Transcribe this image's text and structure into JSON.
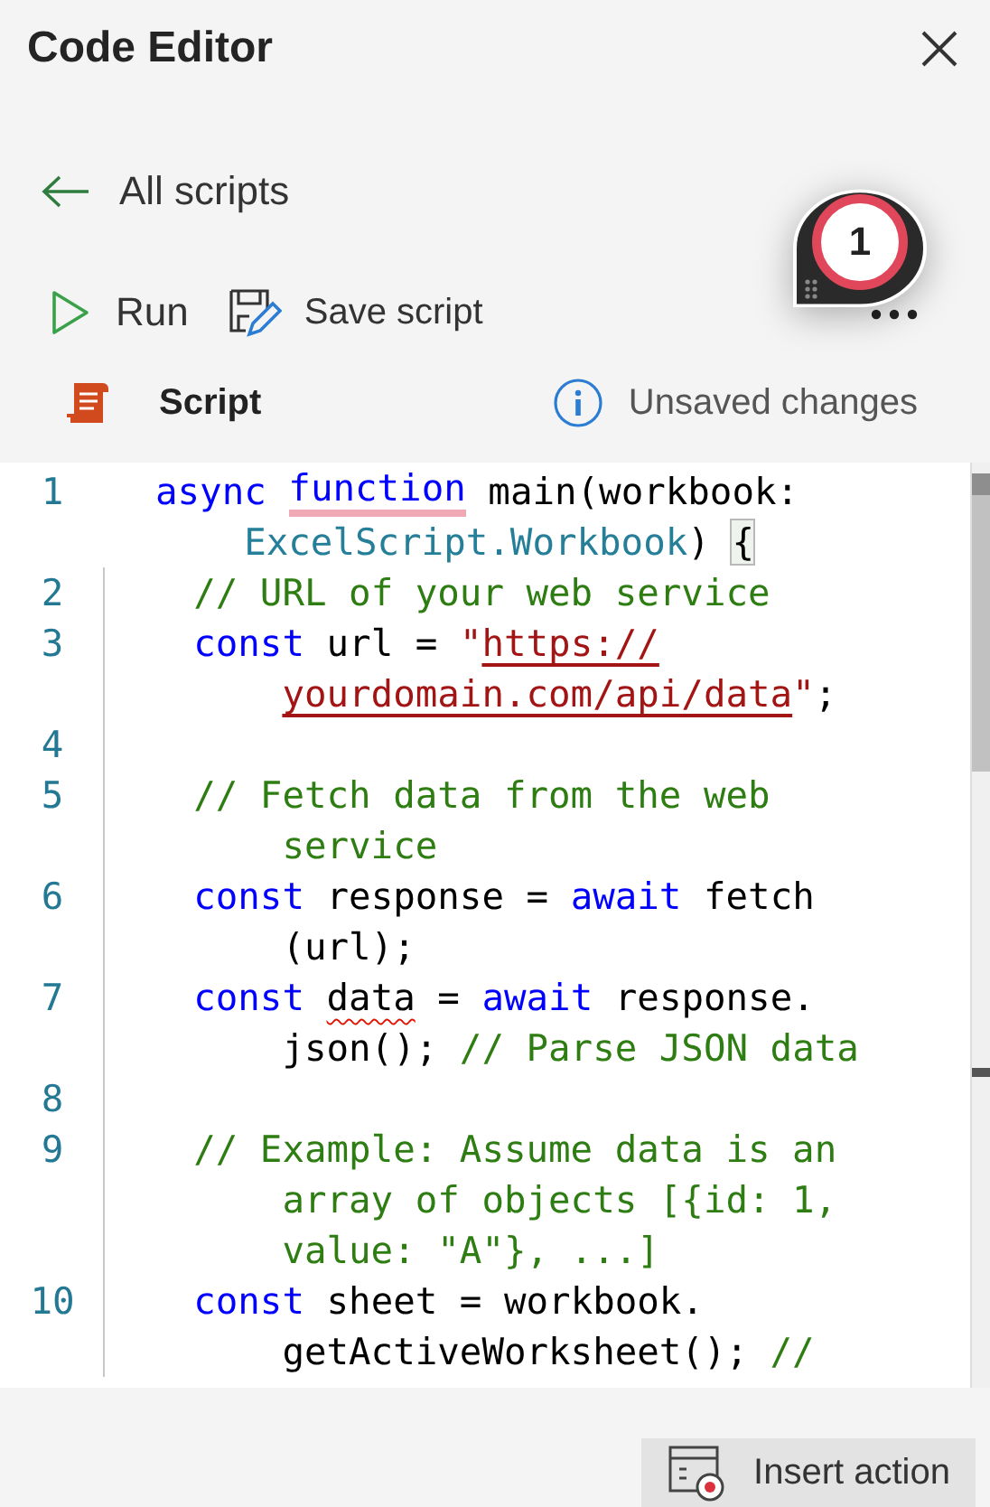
{
  "header": {
    "title": "Code Editor"
  },
  "back_link": {
    "label": "All scripts"
  },
  "toolbar": [
    {
      "kind": "run",
      "label": "Run"
    },
    {
      "kind": "save",
      "label": "Save script"
    }
  ],
  "step_badge": {
    "label": "1"
  },
  "script_bar": {
    "label": "Script",
    "status": "Unsaved changes"
  },
  "code_lines": [
    {
      "number": "1",
      "rows": [
        {
          "segments": [
            {
              "text": "async ",
              "kind": "keyword"
            },
            {
              "text": "function",
              "kind": "keyword",
              "warning": true
            },
            {
              "text": " main(workbook:",
              "kind": "plain"
            }
          ]
        },
        {
          "segments": [
            {
              "text": "ExcelScript.",
              "kind": "type"
            },
            {
              "text": "Workbook",
              "kind": "type"
            },
            {
              "text": ") ",
              "kind": "plain"
            },
            {
              "text": "{",
              "kind": "plain",
              "bracket_match": true
            }
          ]
        }
      ]
    },
    {
      "number": "2",
      "rows": [
        {
          "segments": [
            {
              "text": "    // URL of your web service",
              "kind": "comment"
            }
          ]
        }
      ]
    },
    {
      "number": "3",
      "rows": [
        {
          "segments": [
            {
              "text": "    const",
              "kind": "keyword"
            },
            {
              "text": " url = ",
              "kind": "plain"
            },
            {
              "text": "\"",
              "kind": "string"
            },
            {
              "text": "https://",
              "kind": "string",
              "link": true
            }
          ]
        },
        {
          "segments": [
            {
              "text": "yourdomain.com/api/data",
              "kind": "string",
              "link": true
            },
            {
              "text": "\"",
              "kind": "string"
            },
            {
              "text": ";",
              "kind": "plain"
            }
          ]
        }
      ]
    },
    {
      "number": "4"
    },
    {
      "number": "5",
      "rows": [
        {
          "segments": [
            {
              "text": "    // Fetch data from the web",
              "kind": "comment"
            }
          ]
        },
        {
          "segments": [
            {
              "text": "service",
              "kind": "comment"
            }
          ]
        }
      ]
    },
    {
      "number": "6",
      "rows": [
        {
          "segments": [
            {
              "text": "    const",
              "kind": "keyword"
            },
            {
              "text": " response = ",
              "kind": "plain"
            },
            {
              "text": "await",
              "kind": "keyword"
            },
            {
              "text": " fetch",
              "kind": "plain"
            }
          ]
        },
        {
          "segments": [
            {
              "text": "(url);",
              "kind": "plain"
            }
          ]
        }
      ]
    },
    {
      "number": "7",
      "rows": [
        {
          "segments": [
            {
              "text": "    const ",
              "kind": "keyword"
            },
            {
              "text": "data",
              "kind": "plain",
              "error": true
            },
            {
              "text": " = ",
              "kind": "plain"
            },
            {
              "text": "await",
              "kind": "keyword"
            },
            {
              "text": " response.",
              "kind": "plain"
            }
          ]
        },
        {
          "segments": [
            {
              "text": "json(); ",
              "kind": "plain"
            },
            {
              "text": "// Parse JSON data",
              "kind": "comment"
            }
          ]
        }
      ]
    },
    {
      "number": "8"
    },
    {
      "number": "9",
      "rows": [
        {
          "segments": [
            {
              "text": "    // Example: Assume data is an",
              "kind": "comment"
            }
          ]
        },
        {
          "segments": [
            {
              "text": "array of objects [{id: 1,",
              "kind": "comment"
            }
          ]
        },
        {
          "segments": [
            {
              "text": "value: \"A\"}, ...]",
              "kind": "comment"
            }
          ]
        }
      ]
    },
    {
      "number": "10",
      "rows": [
        {
          "segments": [
            {
              "text": "    const",
              "kind": "keyword"
            },
            {
              "text": " sheet = workbook.",
              "kind": "plain"
            }
          ]
        },
        {
          "segments": [
            {
              "text": "getActiveWorksheet(); ",
              "kind": "plain"
            },
            {
              "text": "//",
              "kind": "comment"
            }
          ]
        }
      ]
    }
  ],
  "footer": {
    "button": "Insert action"
  }
}
